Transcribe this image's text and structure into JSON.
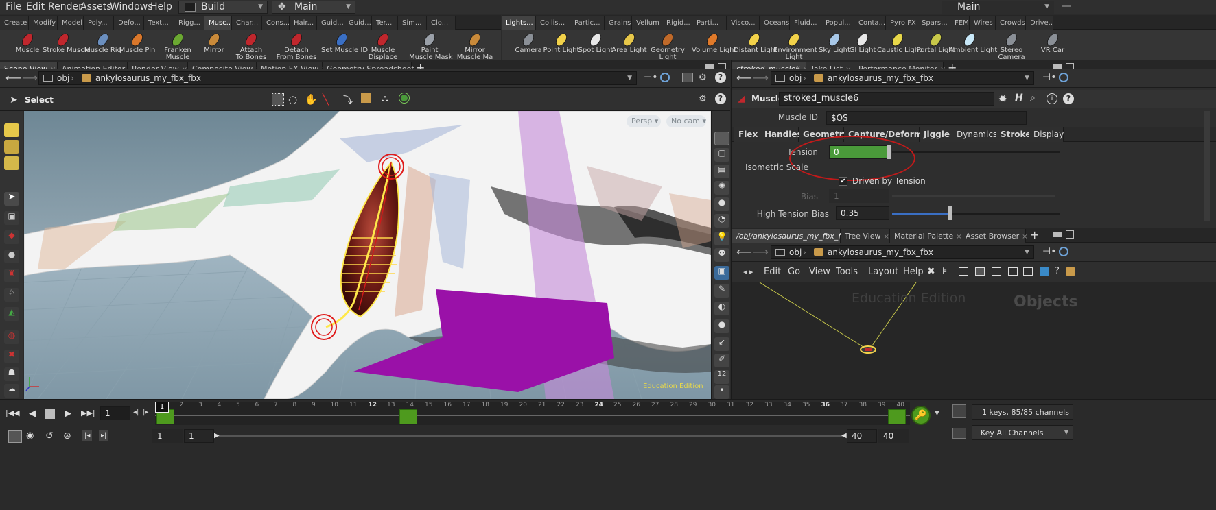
{
  "menu": {
    "items": [
      "File",
      "Edit",
      "Render",
      "Assets",
      "Windows",
      "Help"
    ],
    "desktop": "Build",
    "context": "Main",
    "right_context": "Main"
  },
  "shelf_tabs_left": [
    "Create",
    "Modify",
    "Model",
    "Poly...",
    "Defo...",
    "Text...",
    "Rigg...",
    "Musc...",
    "Char...",
    "Cons...",
    "Hair...",
    "Guid...",
    "Guid...",
    "Ter...",
    "Sim...",
    "Clo..."
  ],
  "shelf_tabs_right": [
    "Lights...",
    "Collis...",
    "Partic...",
    "Grains",
    "Vellum",
    "Rigid...",
    "Parti...",
    "Visco...",
    "Oceans",
    "Fluid...",
    "Popul...",
    "Conta...",
    "Pyro FX",
    "Spars...",
    "FEM",
    "Wires",
    "Crowds",
    "Drive..."
  ],
  "tools_left": [
    {
      "l1": "Muscle",
      "l2": "",
      "icon": "muscle-icon",
      "color": "#c0272d"
    },
    {
      "l1": "Stroke Muscle",
      "l2": "",
      "icon": "stroke-muscle-icon",
      "color": "#c0272d"
    },
    {
      "l1": "Muscle Rig",
      "l2": "",
      "icon": "muscle-rig-icon",
      "color": "#6b8fbf"
    },
    {
      "l1": "Muscle Pin",
      "l2": "",
      "icon": "muscle-pin-icon",
      "color": "#d9772b"
    },
    {
      "l1": "Franken",
      "l2": "Muscle",
      "icon": "franken-muscle-icon",
      "color": "#6ba832"
    },
    {
      "l1": "Mirror",
      "l2": "",
      "icon": "mirror-icon",
      "color": "#c98a3a"
    },
    {
      "l1": "Attach",
      "l2": "To Bones",
      "icon": "attach-bones-icon",
      "color": "#c0272d"
    },
    {
      "l1": "Detach",
      "l2": "From Bones",
      "icon": "detach-bones-icon",
      "color": "#c0272d"
    },
    {
      "l1": "Set Muscle ID",
      "l2": "",
      "icon": "set-muscle-id-icon",
      "color": "#3a6fc4"
    },
    {
      "l1": "Muscle",
      "l2": "Displace",
      "icon": "muscle-displace-icon",
      "color": "#c0272d"
    },
    {
      "l1": "Paint",
      "l2": "Muscle Mask",
      "icon": "paint-mask-icon",
      "color": "#9aa0a8"
    },
    {
      "l1": "Mirror",
      "l2": "Muscle Ma",
      "icon": "mirror-muscle-icon",
      "color": "#c98a3a"
    }
  ],
  "tools_right": [
    {
      "l1": "Camera",
      "l2": "",
      "icon": "camera-icon",
      "color": "#8a8f96"
    },
    {
      "l1": "Point Light",
      "l2": "",
      "icon": "point-light-icon",
      "color": "#f2d24a"
    },
    {
      "l1": "Spot Light",
      "l2": "",
      "icon": "spot-light-icon",
      "color": "#e8e8e8"
    },
    {
      "l1": "Area Light",
      "l2": "",
      "icon": "area-light-icon",
      "color": "#e8c84a"
    },
    {
      "l1": "Geometry",
      "l2": "Light",
      "icon": "geometry-light-icon",
      "color": "#c06a2a"
    },
    {
      "l1": "Volume Light",
      "l2": "",
      "icon": "volume-light-icon",
      "color": "#e07a2a"
    },
    {
      "l1": "Distant Light",
      "l2": "",
      "icon": "distant-light-icon",
      "color": "#f2d24a"
    },
    {
      "l1": "Environment",
      "l2": "Light",
      "icon": "environment-light-icon",
      "color": "#f2d24a"
    },
    {
      "l1": "Sky Light",
      "l2": "",
      "icon": "sky-light-icon",
      "color": "#a8c8e8"
    },
    {
      "l1": "GI Light",
      "l2": "",
      "icon": "gi-light-icon",
      "color": "#e8e8e8"
    },
    {
      "l1": "Caustic Light",
      "l2": "",
      "icon": "caustic-light-icon",
      "color": "#e8d84a"
    },
    {
      "l1": "Portal Light",
      "l2": "",
      "icon": "portal-light-icon",
      "color": "#c8c84a"
    },
    {
      "l1": "Ambient Light",
      "l2": "",
      "icon": "ambient-light-icon",
      "color": "#c8e8f8"
    },
    {
      "l1": "Stereo",
      "l2": "Camera",
      "icon": "stereo-camera-icon",
      "color": "#8a8f96"
    },
    {
      "l1": "VR Car",
      "l2": "",
      "icon": "vr-camera-icon",
      "color": "#8a8f96"
    }
  ],
  "viewer": {
    "tabs": [
      "Scene View",
      "Animation Editor",
      "Render View",
      "Composite View",
      "Motion FX View",
      "Geometry Spreadsheet"
    ],
    "path_root": "obj",
    "path_node": "ankylosaurus_my_fbx_fbx",
    "tool_label": "Select",
    "persp": "Persp",
    "cam": "No cam",
    "watermark": "Education Edition"
  },
  "params": {
    "tabs": [
      "stroked_muscle6",
      "Take List",
      "Performance Monitor"
    ],
    "path_root": "obj",
    "path_node": "ankylosaurus_my_fbx_fbx",
    "node_type": "Muscle",
    "node_name": "stroked_muscle6",
    "muscle_id_label": "Muscle ID",
    "muscle_id": "$OS",
    "subtabs": [
      "Flex",
      "Handles",
      "Geometry",
      "Capture/Deform",
      "Jiggle",
      "Dynamics",
      "Stroke",
      "Display"
    ],
    "tension_label": "Tension",
    "tension": "0",
    "iso_label": "Isometric Scale",
    "driven_label": "Driven by Tension",
    "bias_label": "Bias",
    "bias": "1",
    "htb_label": "High Tension Bias",
    "htb": "0.35"
  },
  "network": {
    "tabs": [
      "/obj/ankylosaurus_my_fbx_fbx",
      "Tree View",
      "Material Palette",
      "Asset Browser"
    ],
    "path_root": "obj",
    "path_node": "ankylosaurus_my_fbx_fbx",
    "menu": [
      "Edit",
      "Go",
      "View",
      "Tools",
      "Layout",
      "Help"
    ],
    "watermark": "Education Edition",
    "context": "Objects"
  },
  "timeline": {
    "frame": "1",
    "ticks": [
      "1",
      "2",
      "3",
      "4",
      "5",
      "6",
      "7",
      "8",
      "9",
      "10",
      "11",
      "12",
      "13",
      "14",
      "15",
      "16",
      "17",
      "18",
      "19",
      "20",
      "21",
      "22",
      "23",
      "24",
      "25",
      "26",
      "27",
      "28",
      "29",
      "30",
      "31",
      "32",
      "33",
      "34",
      "35",
      "36",
      "37",
      "38",
      "39",
      "40"
    ],
    "start": "1",
    "range_start": "1",
    "range_end": "40",
    "end": "40",
    "keys_info": "1 keys, 85/85 channels",
    "key_mode": "Key All Channels"
  }
}
